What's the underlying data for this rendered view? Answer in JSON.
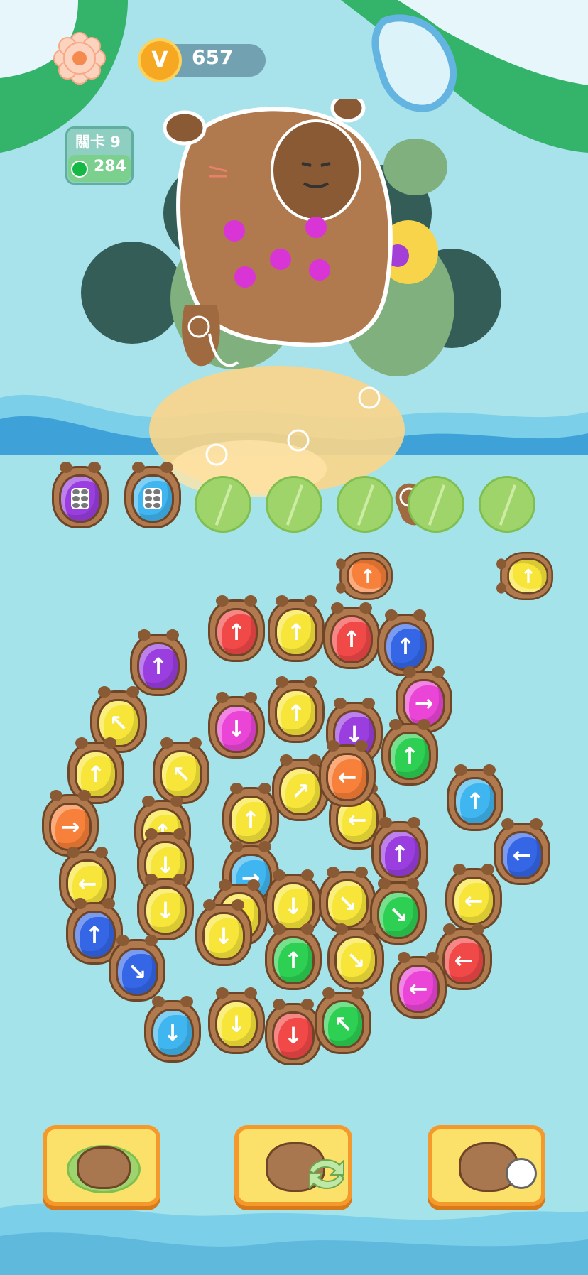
{
  "hud": {
    "coins": "657",
    "coin_icon_glyph": "V",
    "level_label": "關卡 9",
    "gems": "284"
  },
  "colors": {
    "red": "#f14848",
    "yellow": "#f7e53a",
    "purple": "#9a3ee0",
    "magenta": "#ea45d6",
    "green": "#2dd052",
    "blue": "#3466e6",
    "orange": "#f7803a",
    "cyan": "#3fb6ef"
  },
  "queue_capybaras": [
    {
      "color": "purple",
      "arrow": "grid"
    },
    {
      "color": "cyan",
      "arrow": "grid"
    }
  ],
  "moving_capybaras": [
    {
      "color": "orange",
      "arrow": "→"
    },
    {
      "color": "yellow",
      "arrow": "→"
    }
  ],
  "board_capybaras": [
    {
      "color": "red",
      "arrow": "↑"
    },
    {
      "color": "yellow",
      "arrow": "↑"
    },
    {
      "color": "red",
      "arrow": "↑"
    },
    {
      "color": "blue",
      "arrow": "↑"
    },
    {
      "color": "purple",
      "arrow": "↑"
    },
    {
      "color": "magenta",
      "arrow": "↓"
    },
    {
      "color": "yellow",
      "arrow": "↑"
    },
    {
      "color": "purple",
      "arrow": "↓"
    },
    {
      "color": "magenta",
      "arrow": "→"
    },
    {
      "color": "yellow",
      "arrow": "↖"
    },
    {
      "color": "yellow",
      "arrow": "↖"
    },
    {
      "color": "yellow",
      "arrow": "↑"
    },
    {
      "color": "yellow",
      "arrow": "↗"
    },
    {
      "color": "yellow",
      "arrow": "←"
    },
    {
      "color": "green",
      "arrow": "↑"
    },
    {
      "color": "yellow",
      "arrow": "↑"
    },
    {
      "color": "yellow",
      "arrow": "↑"
    },
    {
      "color": "orange",
      "arrow": "←"
    },
    {
      "color": "cyan",
      "arrow": "↑"
    },
    {
      "color": "orange",
      "arrow": "→"
    },
    {
      "color": "yellow",
      "arrow": "↓"
    },
    {
      "color": "cyan",
      "arrow": "→"
    },
    {
      "color": "purple",
      "arrow": "↑"
    },
    {
      "color": "blue",
      "arrow": "←"
    },
    {
      "color": "yellow",
      "arrow": "←"
    },
    {
      "color": "yellow",
      "arrow": "↓"
    },
    {
      "color": "yellow",
      "arrow": "↓"
    },
    {
      "color": "yellow",
      "arrow": "↓"
    },
    {
      "color": "yellow",
      "arrow": "↘"
    },
    {
      "color": "green",
      "arrow": "↘"
    },
    {
      "color": "yellow",
      "arrow": "←"
    },
    {
      "color": "blue",
      "arrow": "↑"
    },
    {
      "color": "yellow",
      "arrow": "↓"
    },
    {
      "color": "green",
      "arrow": "↑"
    },
    {
      "color": "yellow",
      "arrow": "↘"
    },
    {
      "color": "red",
      "arrow": "←"
    },
    {
      "color": "blue",
      "arrow": "↘"
    },
    {
      "color": "magenta",
      "arrow": "←"
    },
    {
      "color": "cyan",
      "arrow": "↓"
    },
    {
      "color": "yellow",
      "arrow": "↓"
    },
    {
      "color": "red",
      "arrow": "↓"
    },
    {
      "color": "green",
      "arrow": "↖"
    }
  ],
  "powerups": [
    {
      "name": "capybara-on-lilypad"
    },
    {
      "name": "capybara-shuffle"
    },
    {
      "name": "capybara-tap"
    }
  ]
}
